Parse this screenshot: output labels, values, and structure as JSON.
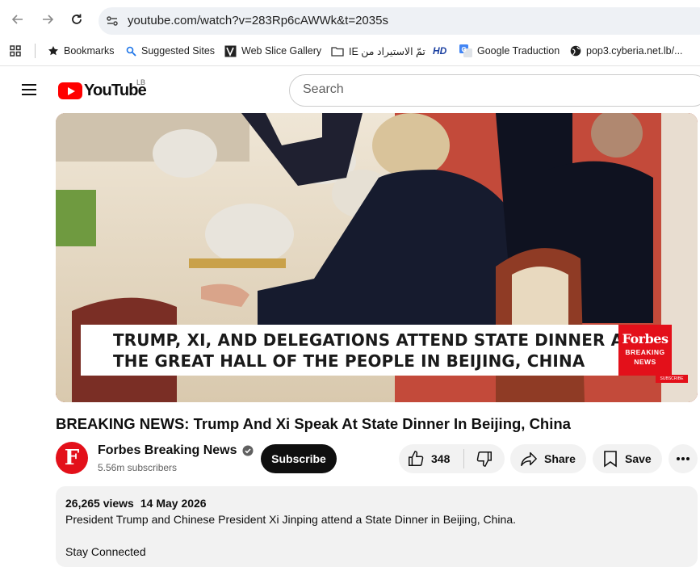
{
  "browser": {
    "url": "youtube.com/watch?v=283Rp6cAWWk&t=2035s",
    "bookmarks": [
      {
        "label": "Bookmarks",
        "icon": "star-icon"
      },
      {
        "label": "Suggested Sites",
        "icon": "search-icon"
      },
      {
        "label": "Web Slice Gallery",
        "icon": "web-slice-icon"
      },
      {
        "label": "IE تمّ الاستيراد من",
        "icon": "folder-icon"
      },
      {
        "label": "HD",
        "icon": "hd-icon"
      },
      {
        "label": "Google Traduction",
        "icon": "google-translate-icon"
      },
      {
        "label": "pop3.cyberia.net.lb/...",
        "icon": "globe-icon"
      }
    ]
  },
  "header": {
    "logo_text": "YouTube",
    "country_code": "LB",
    "search_placeholder": "Search"
  },
  "video": {
    "headline_line1": "TRUMP, XI, AND DELEGATIONS ATTEND STATE DINNER AT",
    "headline_line2": "THE GREAT HALL OF THE PEOPLE IN BEIJING, CHINA",
    "brand": "Forbes",
    "brand_sub1": "BREAKING",
    "brand_sub2": "NEWS",
    "subscribe_tag": "SUBSCRIBE",
    "colors": {
      "brand_red": "#e3101a"
    }
  },
  "title": "BREAKING NEWS: Trump And Xi Speak At State Dinner In Beijing, China",
  "channel": {
    "avatar_letter": "F",
    "name": "Forbes Breaking News",
    "subscribers": "5.56m subscribers",
    "subscribe_label": "Subscribe"
  },
  "actions": {
    "likes": "348",
    "share_label": "Share",
    "save_label": "Save"
  },
  "description": {
    "views": "26,265 views",
    "date": "14 May 2026",
    "line1": "President Trump and Chinese President Xi Jinping attend a State Dinner in Beijing, China.",
    "line2": "Stay Connected"
  }
}
